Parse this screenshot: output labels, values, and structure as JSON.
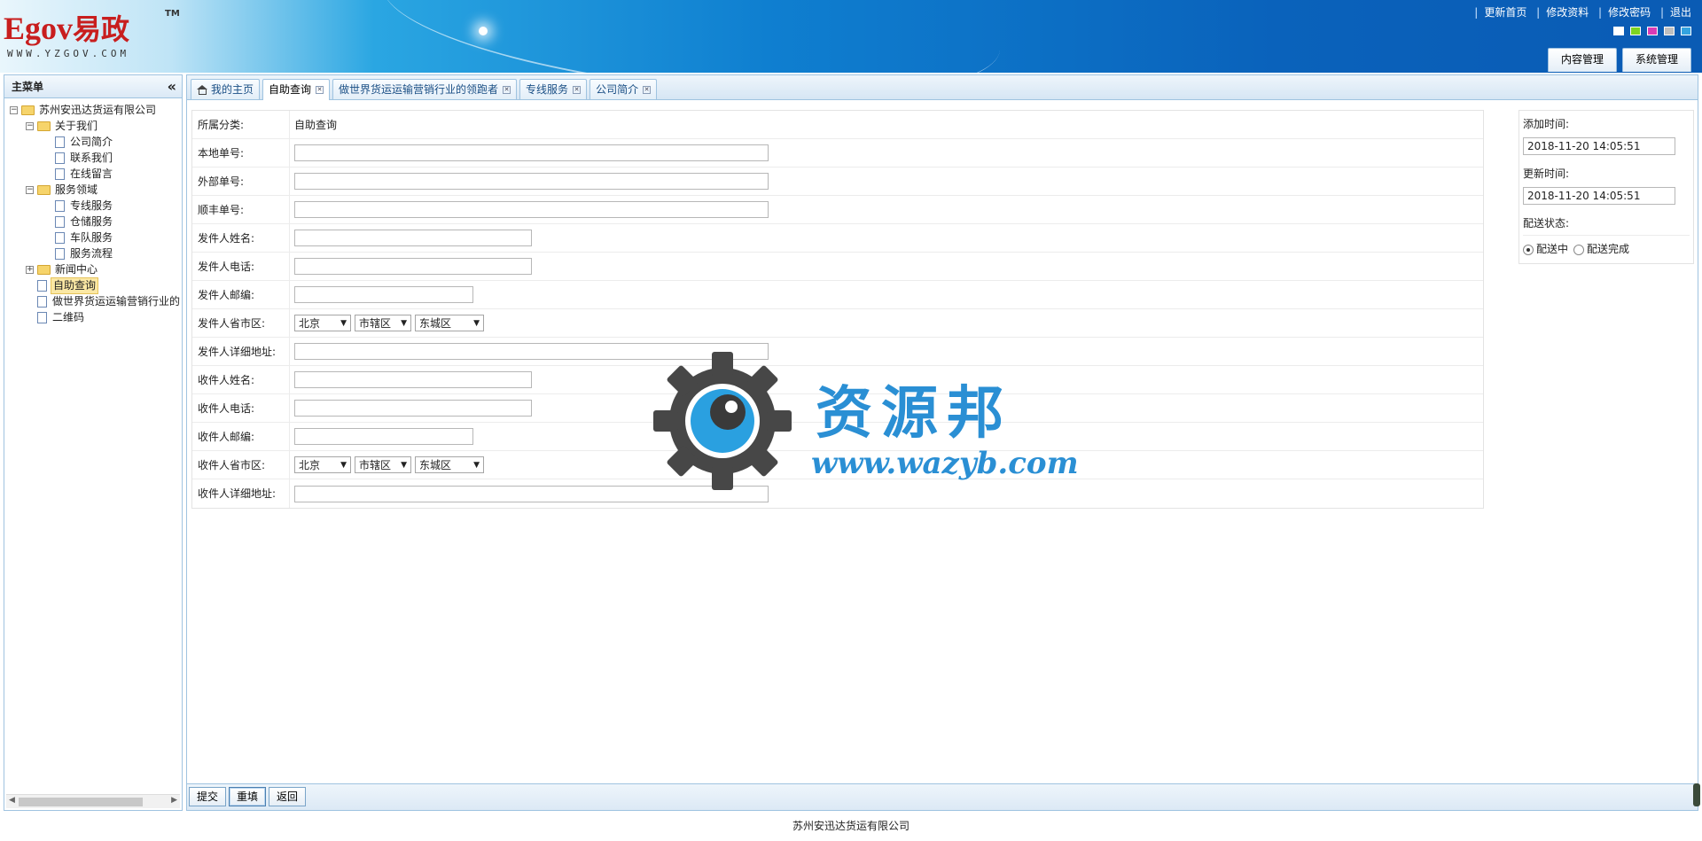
{
  "header": {
    "logo_brand": "Egov",
    "logo_cn": "易政",
    "logo_tm": "TM",
    "logo_url": "WWW.YZGOV.COM",
    "links": [
      "更新首页",
      "修改资料",
      "修改密码",
      "退出"
    ],
    "skin_colors": [
      "#ffffff",
      "#7ed321",
      "#d93bb5",
      "#bfbfbf",
      "#34a3e0"
    ],
    "module_tabs": [
      "内容管理",
      "系统管理"
    ]
  },
  "sidebar": {
    "title": "主菜单",
    "collapse_glyph": "«",
    "tree": [
      {
        "label": "苏州安迅达货运有限公司",
        "type": "folder",
        "level": 0,
        "toggle": "−"
      },
      {
        "label": "关于我们",
        "type": "folder",
        "level": 1,
        "toggle": "−"
      },
      {
        "label": "公司简介",
        "type": "doc",
        "level": 2
      },
      {
        "label": "联系我们",
        "type": "doc",
        "level": 2
      },
      {
        "label": "在线留言",
        "type": "doc",
        "level": 2
      },
      {
        "label": "服务领域",
        "type": "folder",
        "level": 1,
        "toggle": "−"
      },
      {
        "label": "专线服务",
        "type": "doc",
        "level": 2
      },
      {
        "label": "仓储服务",
        "type": "doc",
        "level": 2
      },
      {
        "label": "车队服务",
        "type": "doc",
        "level": 2
      },
      {
        "label": "服务流程",
        "type": "doc",
        "level": 2
      },
      {
        "label": "新闻中心",
        "type": "folder",
        "level": 1,
        "toggle": "+"
      },
      {
        "label": "自助查询",
        "type": "doc",
        "level": 1,
        "selected": true
      },
      {
        "label": "做世界货运运输营销行业的",
        "type": "doc",
        "level": 1
      },
      {
        "label": "二维码",
        "type": "doc",
        "level": 1
      }
    ]
  },
  "tabs": [
    {
      "label": "我的主页",
      "home": true,
      "closable": false
    },
    {
      "label": "自助查询",
      "active": true,
      "closable": true
    },
    {
      "label": "做世界货运运输营销行业的领跑者",
      "closable": true
    },
    {
      "label": "专线服务",
      "closable": true
    },
    {
      "label": "公司简介",
      "closable": true
    }
  ],
  "form": {
    "category_label": "所属分类:",
    "category_value": "自助查询",
    "fields": {
      "local_no": "本地单号:",
      "external_no": "外部单号:",
      "sf_no": "顺丰单号:",
      "sender_name": "发件人姓名:",
      "sender_phone": "发件人电话:",
      "sender_zip": "发件人邮编:",
      "sender_region": "发件人省市区:",
      "sender_address": "发件人详细地址:",
      "receiver_name": "收件人姓名:",
      "receiver_phone": "收件人电话:",
      "receiver_zip": "收件人邮编:",
      "receiver_region": "收件人省市区:",
      "receiver_address": "收件人详细地址:"
    },
    "region": {
      "province": "北京",
      "city": "市辖区",
      "district": "东城区"
    }
  },
  "side": {
    "added_label": "添加时间:",
    "added_value": "2018-11-20 14:05:51",
    "updated_label": "更新时间:",
    "updated_value": "2018-11-20 14:05:51",
    "status_label": "配送状态:",
    "status_options": [
      "配送中",
      "配送完成"
    ],
    "status_selected": "配送中"
  },
  "buttons": {
    "submit": "提交",
    "reset": "重填",
    "back": "返回"
  },
  "footer": "苏州安迅达货运有限公司",
  "watermark": {
    "cn": "资源邦",
    "en": "www.wazyb.com"
  }
}
